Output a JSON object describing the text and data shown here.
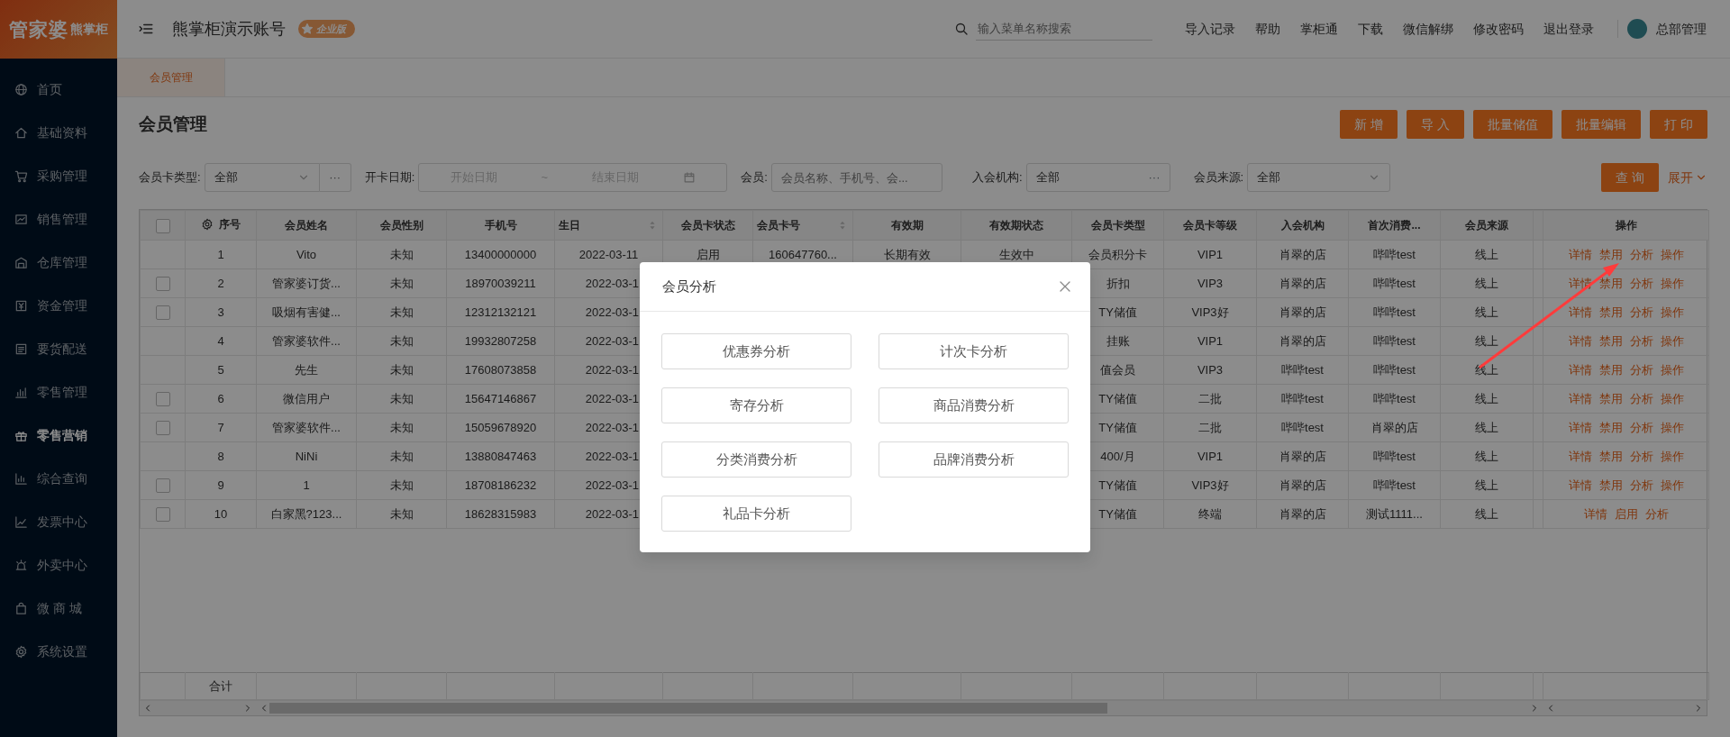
{
  "sidebar": {
    "logo": {
      "main": "管家婆",
      "sub": "熊掌柜"
    },
    "items": [
      {
        "label": "首页",
        "selected": false
      },
      {
        "label": "基础资料",
        "selected": false
      },
      {
        "label": "采购管理",
        "selected": false
      },
      {
        "label": "销售管理",
        "selected": false
      },
      {
        "label": "仓库管理",
        "selected": false
      },
      {
        "label": "资金管理",
        "selected": false
      },
      {
        "label": "要货配送",
        "selected": false
      },
      {
        "label": "零售管理",
        "selected": false
      },
      {
        "label": "零售营销",
        "selected": true
      },
      {
        "label": "综合查询",
        "selected": false
      },
      {
        "label": "发票中心",
        "selected": false
      },
      {
        "label": "外卖中心",
        "selected": false
      },
      {
        "label": "微 商 城",
        "selected": false
      },
      {
        "label": "系统设置",
        "selected": false
      }
    ]
  },
  "header": {
    "account": "熊掌柜演示账号",
    "edition": "企业版",
    "search": {
      "placeholder": "输入菜单名称搜索"
    },
    "links": [
      "导入记录",
      "帮助",
      "掌柜通",
      "下载",
      "微信解绑",
      "修改密码",
      "退出登录"
    ],
    "user": "总部管理"
  },
  "tabs": [
    {
      "label": "会员管理",
      "selected": true
    }
  ],
  "page": {
    "title": "会员管理",
    "actions": [
      "新 增",
      "导 入",
      "批量储值",
      "批量编辑",
      "打 印"
    ]
  },
  "filters": [
    {
      "kind": "select",
      "label": "会员卡类型:",
      "value": "全部",
      "more": "···"
    },
    {
      "kind": "daterange",
      "label": "开卡日期:",
      "start_placeholder": "开始日期",
      "separator": "~",
      "end_placeholder": "结束日期"
    },
    {
      "kind": "text",
      "label": "会员:",
      "placeholder": "会员名称、手机号、会..."
    },
    {
      "kind": "picker",
      "label": "入会机构:",
      "value": "全部",
      "more": "···"
    },
    {
      "kind": "select",
      "label": "会员来源:",
      "value": "全部"
    }
  ],
  "search_button": "查 询",
  "expand_link": "展开",
  "table": {
    "select_all_checked": false,
    "columns": [
      {
        "label": "序号",
        "sortable": false
      },
      {
        "label": "会员姓名",
        "sortable": false
      },
      {
        "label": "会员性别",
        "sortable": false
      },
      {
        "label": "手机号",
        "sortable": false
      },
      {
        "label": "生日",
        "sortable": true
      },
      {
        "label": "会员卡状态",
        "sortable": false
      },
      {
        "label": "会员卡号",
        "sortable": true
      },
      {
        "label": "有效期",
        "sortable": false
      },
      {
        "label": "有效期状态",
        "sortable": false
      },
      {
        "label": "会员卡类型",
        "sortable": false
      },
      {
        "label": "会员卡等级",
        "sortable": false
      },
      {
        "label": "入会机构",
        "sortable": false
      },
      {
        "label": "首次消费...",
        "sortable": false
      },
      {
        "label": "会员来源",
        "sortable": false
      }
    ],
    "action_column": "操作",
    "rows": [
      {
        "selectable": false,
        "cells": {
          "no": "1",
          "name": "Vito",
          "gender": "未知",
          "phone": "13400000000",
          "birthday": "2022-03-11",
          "card_status": "启用",
          "card_no": "160647760...",
          "validity": "长期有效",
          "validity_status": "生效中",
          "card_type": "会员积分卡",
          "level": "VIP1",
          "org": "肖翠的店",
          "first": "哔哔test",
          "source": "线上"
        },
        "actions": [
          "详情",
          "禁用",
          "分析",
          "操作"
        ]
      },
      {
        "selectable": true,
        "cells": {
          "no": "2",
          "name": "管家婆订货...",
          "gender": "未知",
          "phone": "18970039211",
          "birthday": "2022-03-1",
          "card_type": "折扣",
          "level": "VIP3",
          "org": "肖翠的店",
          "first": "哔哔test",
          "source": "线上"
        },
        "actions": [
          "详情",
          "禁用",
          "分析",
          "操作"
        ]
      },
      {
        "selectable": true,
        "cells": {
          "no": "3",
          "name": "吸烟有害健...",
          "gender": "未知",
          "phone": "12312132121",
          "birthday": "2022-03-1",
          "card_type": "TY储值",
          "level": "VIP3好",
          "org": "肖翠的店",
          "first": "哔哔test",
          "source": "线上"
        },
        "actions": [
          "详情",
          "禁用",
          "分析",
          "操作"
        ]
      },
      {
        "selectable": false,
        "cells": {
          "no": "4",
          "name": "管家婆软件...",
          "gender": "未知",
          "phone": "19932807258",
          "birthday": "2022-03-1",
          "card_type": "挂账",
          "level": "VIP1",
          "org": "肖翠的店",
          "first": "哔哔test",
          "source": "线上"
        },
        "actions": [
          "详情",
          "禁用",
          "分析",
          "操作"
        ]
      },
      {
        "selectable": false,
        "cells": {
          "no": "5",
          "name": "先生",
          "gender": "未知",
          "phone": "17608073858",
          "birthday": "2022-03-1",
          "card_type": "值会员",
          "level": "VIP3",
          "org": "哔哔test",
          "first": "哔哔test",
          "source": "线上"
        },
        "actions": [
          "详情",
          "禁用",
          "分析",
          "操作"
        ]
      },
      {
        "selectable": true,
        "cells": {
          "no": "6",
          "name": "微信用户",
          "gender": "未知",
          "phone": "15647146867",
          "birthday": "2022-03-1",
          "card_type": "TY储值",
          "level": "二批",
          "org": "哔哔test",
          "first": "哔哔test",
          "source": "线上"
        },
        "actions": [
          "详情",
          "禁用",
          "分析",
          "操作"
        ]
      },
      {
        "selectable": true,
        "cells": {
          "no": "7",
          "name": "管家婆软件...",
          "gender": "未知",
          "phone": "15059678920",
          "birthday": "2022-03-1",
          "card_type": "TY储值",
          "level": "二批",
          "org": "哔哔test",
          "first": "肖翠的店",
          "source": "线上"
        },
        "actions": [
          "详情",
          "禁用",
          "分析",
          "操作"
        ]
      },
      {
        "selectable": false,
        "cells": {
          "no": "8",
          "name": "NiNi",
          "gender": "未知",
          "phone": "13880847463",
          "birthday": "2022-03-1",
          "card_type": "400/月",
          "level": "VIP1",
          "org": "肖翠的店",
          "first": "哔哔test",
          "source": "线上"
        },
        "actions": [
          "详情",
          "禁用",
          "分析",
          "操作"
        ]
      },
      {
        "selectable": true,
        "cells": {
          "no": "9",
          "name": "1",
          "gender": "未知",
          "phone": "18708186232",
          "birthday": "2022-03-1",
          "card_type": "TY储值",
          "level": "VIP3好",
          "org": "肖翠的店",
          "first": "哔哔test",
          "source": "线上"
        },
        "actions": [
          "详情",
          "禁用",
          "分析",
          "操作"
        ]
      },
      {
        "selectable": true,
        "cells": {
          "no": "10",
          "name": "白家黑?123...",
          "gender": "未知",
          "phone": "18628315983",
          "birthday": "2022-03-1",
          "card_type": "TY储值",
          "level": "终端",
          "org": "肖翠的店",
          "first": "测试1111...",
          "source": "线上"
        },
        "actions": [
          "详情",
          "启用",
          "分析"
        ]
      }
    ],
    "total_label": "合计"
  },
  "modal": {
    "title": "会员分析",
    "buttons": [
      "优惠券分析",
      "计次卡分析",
      "寄存分析",
      "商品消费分析",
      "分类消费分析",
      "品牌消费分析",
      "礼品卡分析"
    ]
  }
}
